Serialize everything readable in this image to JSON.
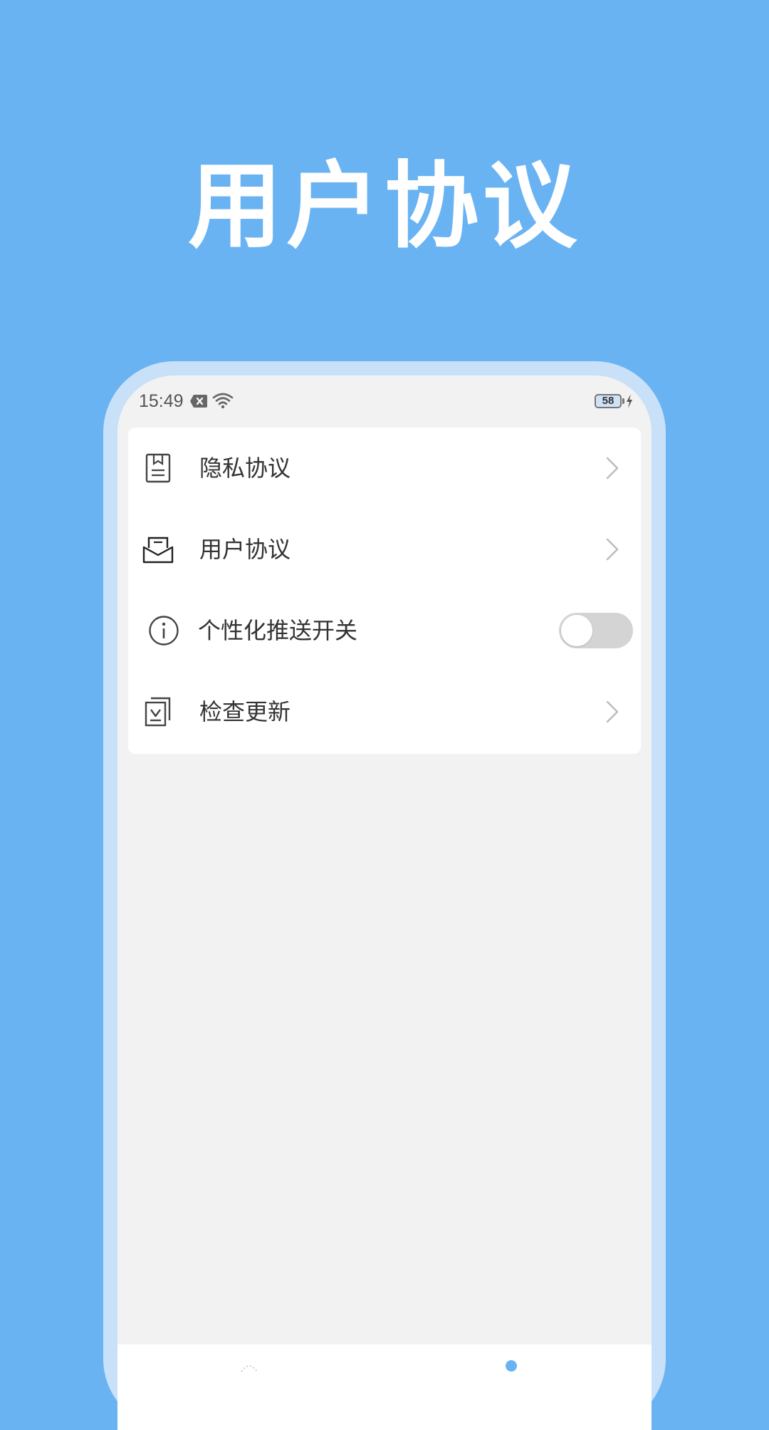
{
  "hero": {
    "title": "用户协议"
  },
  "status_bar": {
    "time": "15:49",
    "battery": "58",
    "icons": [
      "notification-x-icon",
      "wifi-icon",
      "battery-icon",
      "charging-icon"
    ]
  },
  "menu": {
    "items": [
      {
        "label": "隐私协议",
        "icon": "document-icon",
        "action": "chevron-right-icon"
      },
      {
        "label": "用户协议",
        "icon": "mail-tray-icon",
        "action": "chevron-right-icon"
      },
      {
        "label": "个性化推送开关",
        "icon": "info-icon",
        "action": "toggle",
        "toggle_on": false
      },
      {
        "label": "检查更新",
        "icon": "update-icon",
        "action": "chevron-right-icon"
      }
    ]
  },
  "bottom_nav": {
    "icons": [
      "home-icon",
      "profile-icon"
    ]
  },
  "colors": {
    "background": "#6AB3F3",
    "phone_frame": "#C9E1F8",
    "screen": "#F2F2F2",
    "card": "#FFFFFF",
    "toggle_off": "#D4D4D4",
    "text": "#333333"
  }
}
